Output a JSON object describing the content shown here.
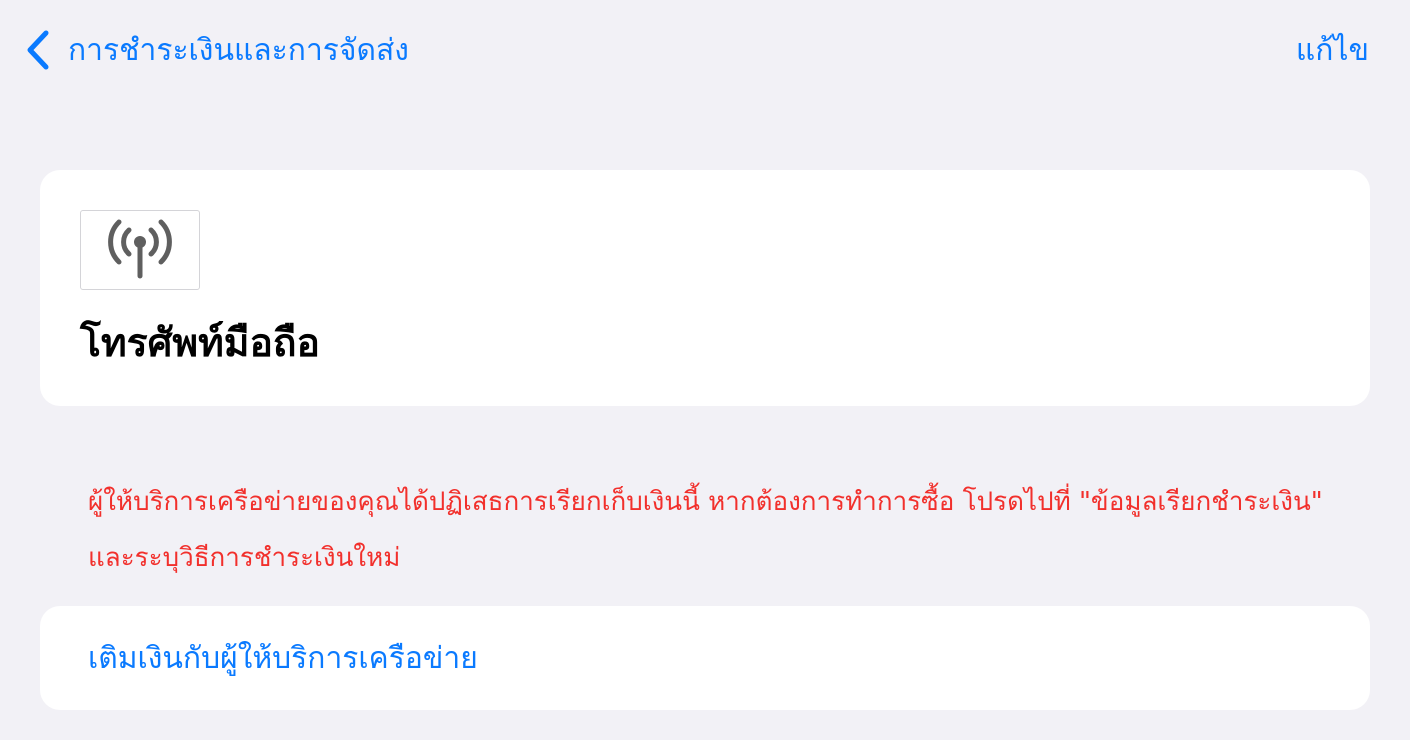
{
  "nav": {
    "back_label": "การชำระเงินและการจัดส่ง",
    "back_icon": "chevron-left-icon",
    "edit_label": "แก้ไข"
  },
  "payment_method": {
    "icon": "cellular-antenna-icon",
    "title": "โทรศัพท์มือถือ"
  },
  "error": {
    "message": "ผู้ให้บริการเครือข่ายของคุณได้ปฏิเสธการเรียกเก็บเงินนี้ หากต้องการทำการซื้อ โปรดไปที่ \"ข้อมูลเรียกชำระเงิน\" และระบุวิธีการชำระเงินใหม่"
  },
  "action": {
    "label": "เติมเงินกับผู้ให้บริการเครือข่าย"
  },
  "colors": {
    "background": "#f2f1f6",
    "accent": "#0a7aff",
    "error": "#f2302c",
    "card": "#ffffff",
    "icon": "#5f5f5f"
  }
}
